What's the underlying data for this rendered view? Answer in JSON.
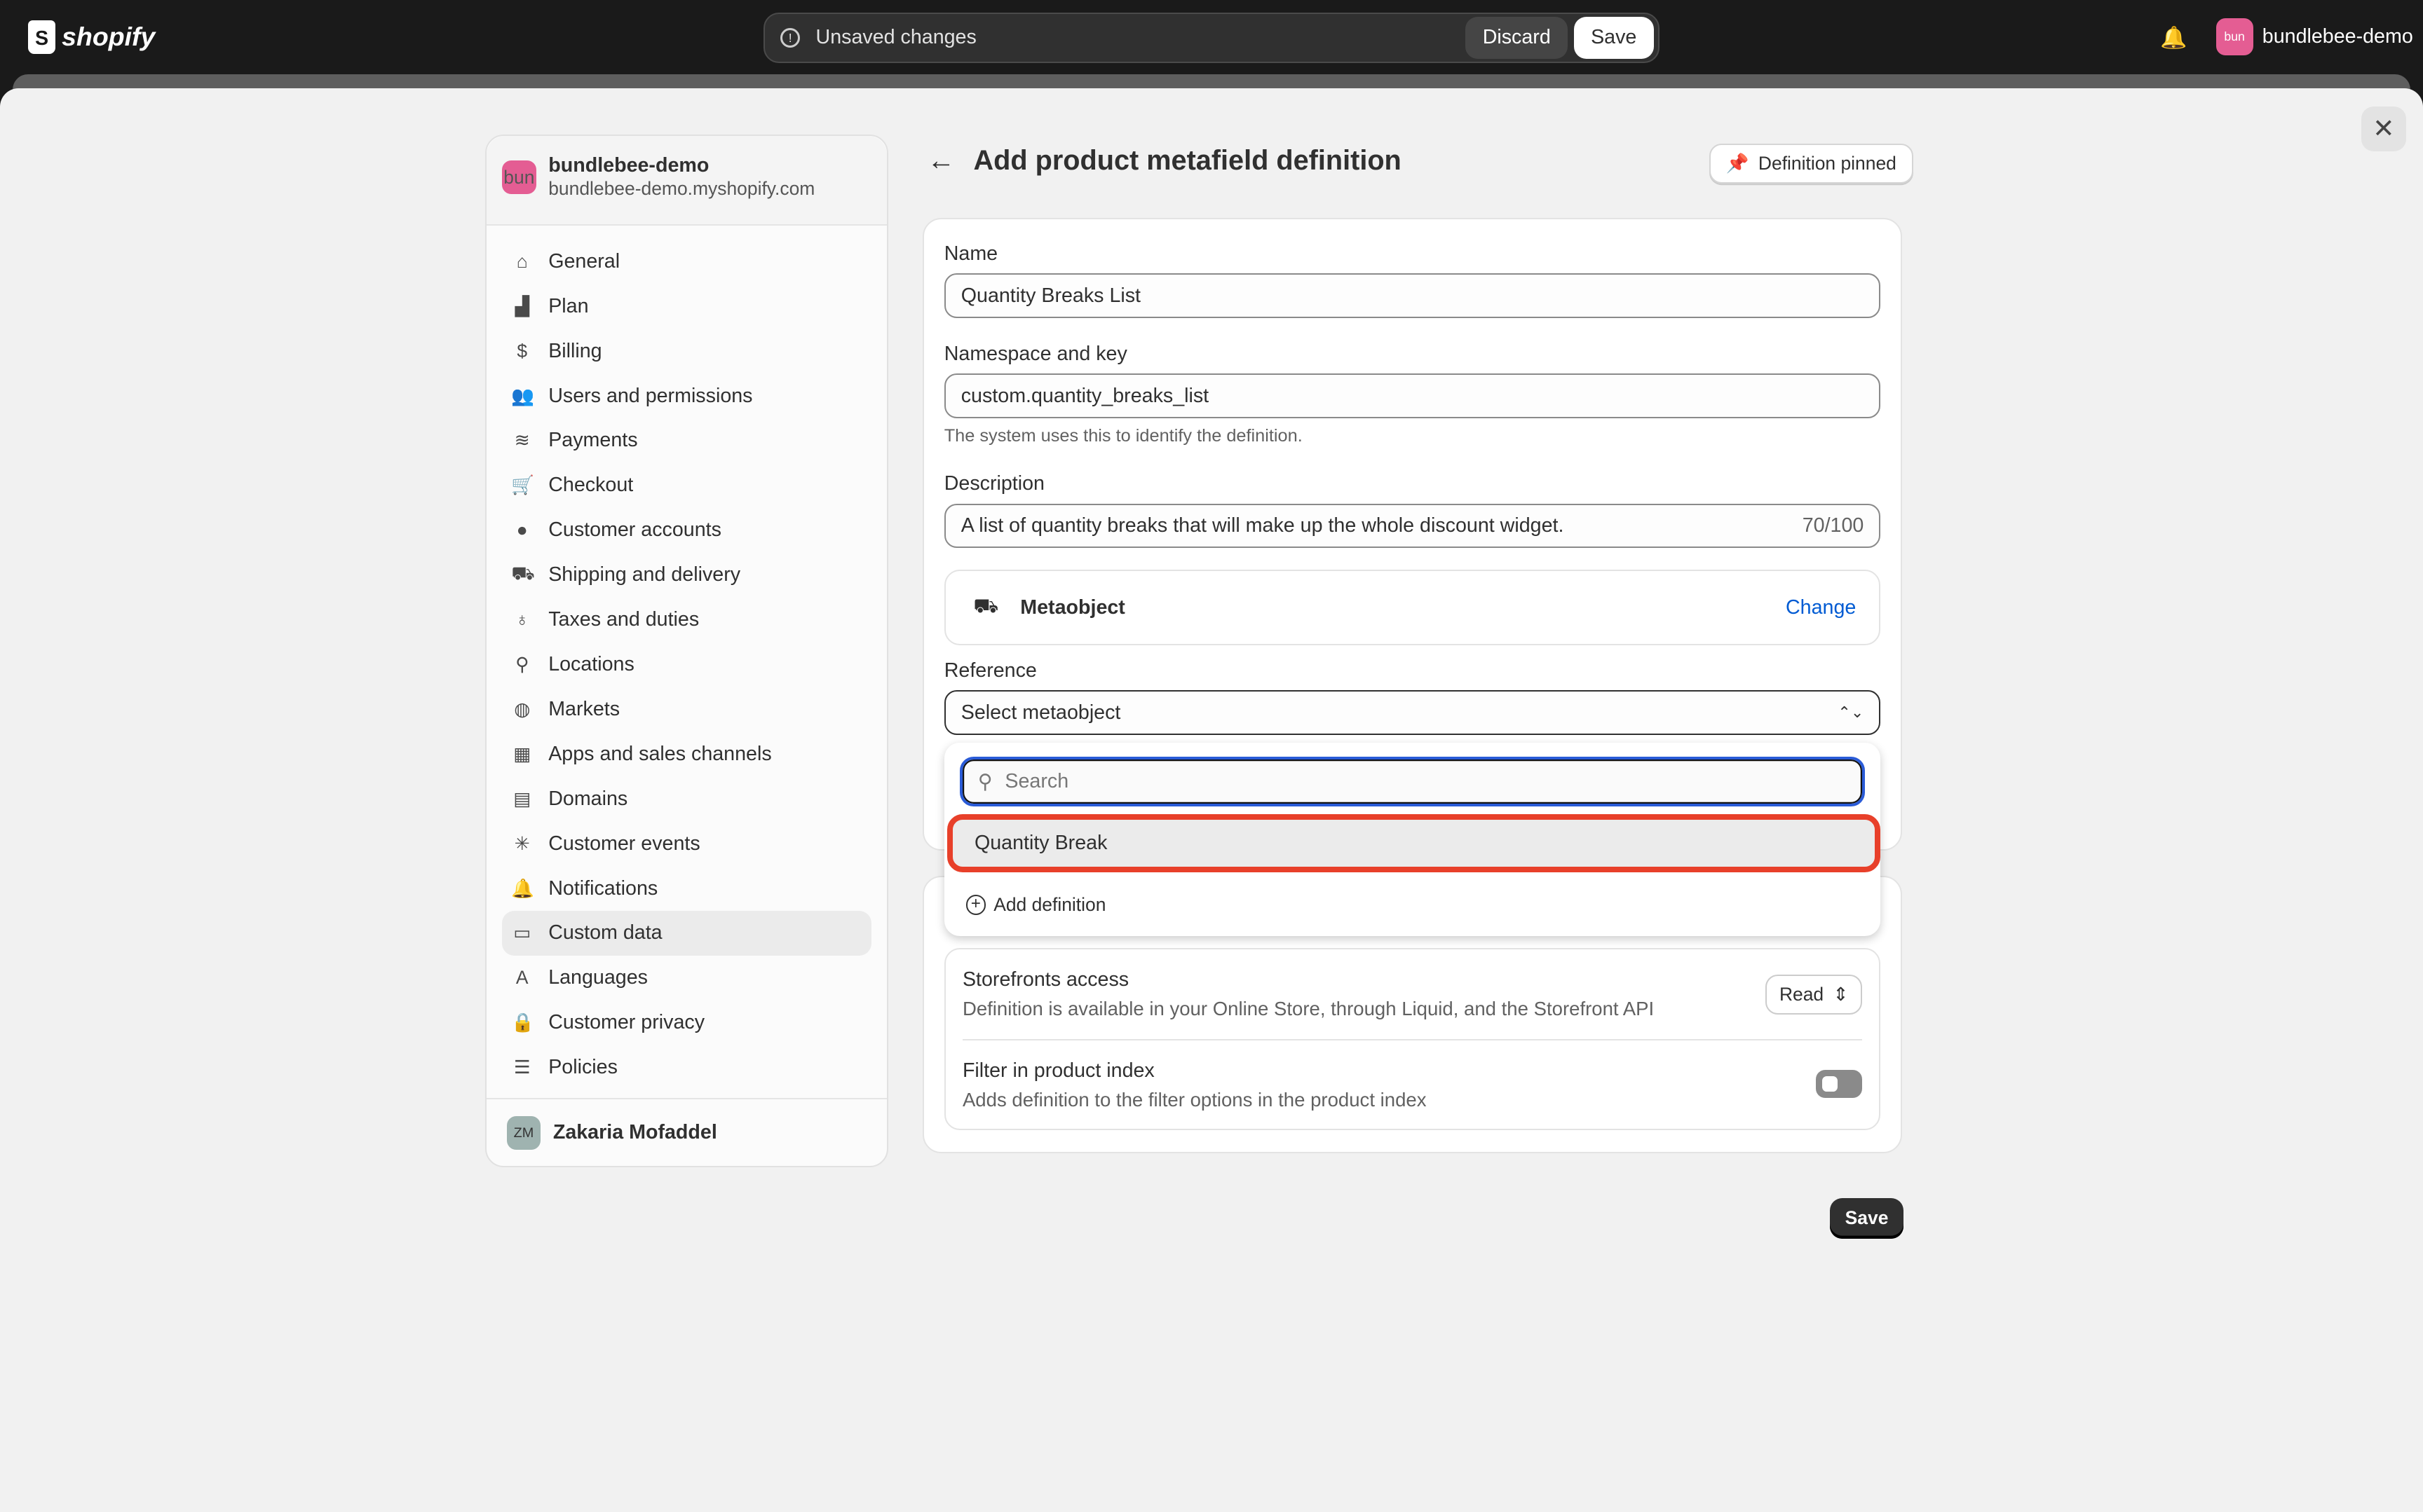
{
  "topbar": {
    "brand": "shopify",
    "unsaved": "Unsaved changes",
    "discard": "Discard",
    "save": "Save",
    "account": "bundlebee-demo",
    "avatar": "bun"
  },
  "sidebar": {
    "store_name": "bundlebee-demo",
    "store_url": "bundlebee-demo.myshopify.com",
    "avatar": "bun",
    "items": [
      {
        "label": "General",
        "icon": "⌂"
      },
      {
        "label": "Plan",
        "icon": "▟"
      },
      {
        "label": "Billing",
        "icon": "$"
      },
      {
        "label": "Users and permissions",
        "icon": "👥"
      },
      {
        "label": "Payments",
        "icon": "≋"
      },
      {
        "label": "Checkout",
        "icon": "🛒"
      },
      {
        "label": "Customer accounts",
        "icon": "●"
      },
      {
        "label": "Shipping and delivery",
        "icon": "⛟"
      },
      {
        "label": "Taxes and duties",
        "icon": "♁"
      },
      {
        "label": "Locations",
        "icon": "⚲"
      },
      {
        "label": "Markets",
        "icon": "◍"
      },
      {
        "label": "Apps and sales channels",
        "icon": "▦"
      },
      {
        "label": "Domains",
        "icon": "▤"
      },
      {
        "label": "Customer events",
        "icon": "✳"
      },
      {
        "label": "Notifications",
        "icon": "🔔"
      },
      {
        "label": "Custom data",
        "icon": "▭",
        "selected": true
      },
      {
        "label": "Languages",
        "icon": "A"
      },
      {
        "label": "Customer privacy",
        "icon": "🔒"
      },
      {
        "label": "Policies",
        "icon": "☰"
      }
    ],
    "user": {
      "initials": "ZM",
      "name": "Zakaria Mofaddel"
    }
  },
  "main": {
    "title": "Add product metafield definition",
    "pinned": "Definition pinned",
    "name_label": "Name",
    "name_value": "Quantity Breaks List",
    "ns_label": "Namespace and key",
    "ns_value": "custom.quantity_breaks_list",
    "ns_help": "The system uses this to identify the definition.",
    "desc_label": "Description",
    "desc_value": "A list of quantity breaks that will make up the whole discount widget.",
    "desc_count": "70/100",
    "type": "Metaobject",
    "change": "Change",
    "ref_label": "Reference",
    "ref_value": "Select metaobject",
    "search_placeholder": "Search",
    "option": "Quantity Break",
    "add_definition": "Add definition",
    "storefront_title": "Storefronts access",
    "storefront_desc": "Definition is available in your Online Store, through Liquid, and the Storefront API",
    "storefront_value": "Read",
    "filter_title": "Filter in product index",
    "filter_desc": "Adds definition to the filter options in the product index",
    "filter_on": false,
    "save": "Save"
  },
  "colors": {
    "highlight": "#e8402a",
    "focus": "#2a5bd7",
    "link": "#005bd3"
  }
}
